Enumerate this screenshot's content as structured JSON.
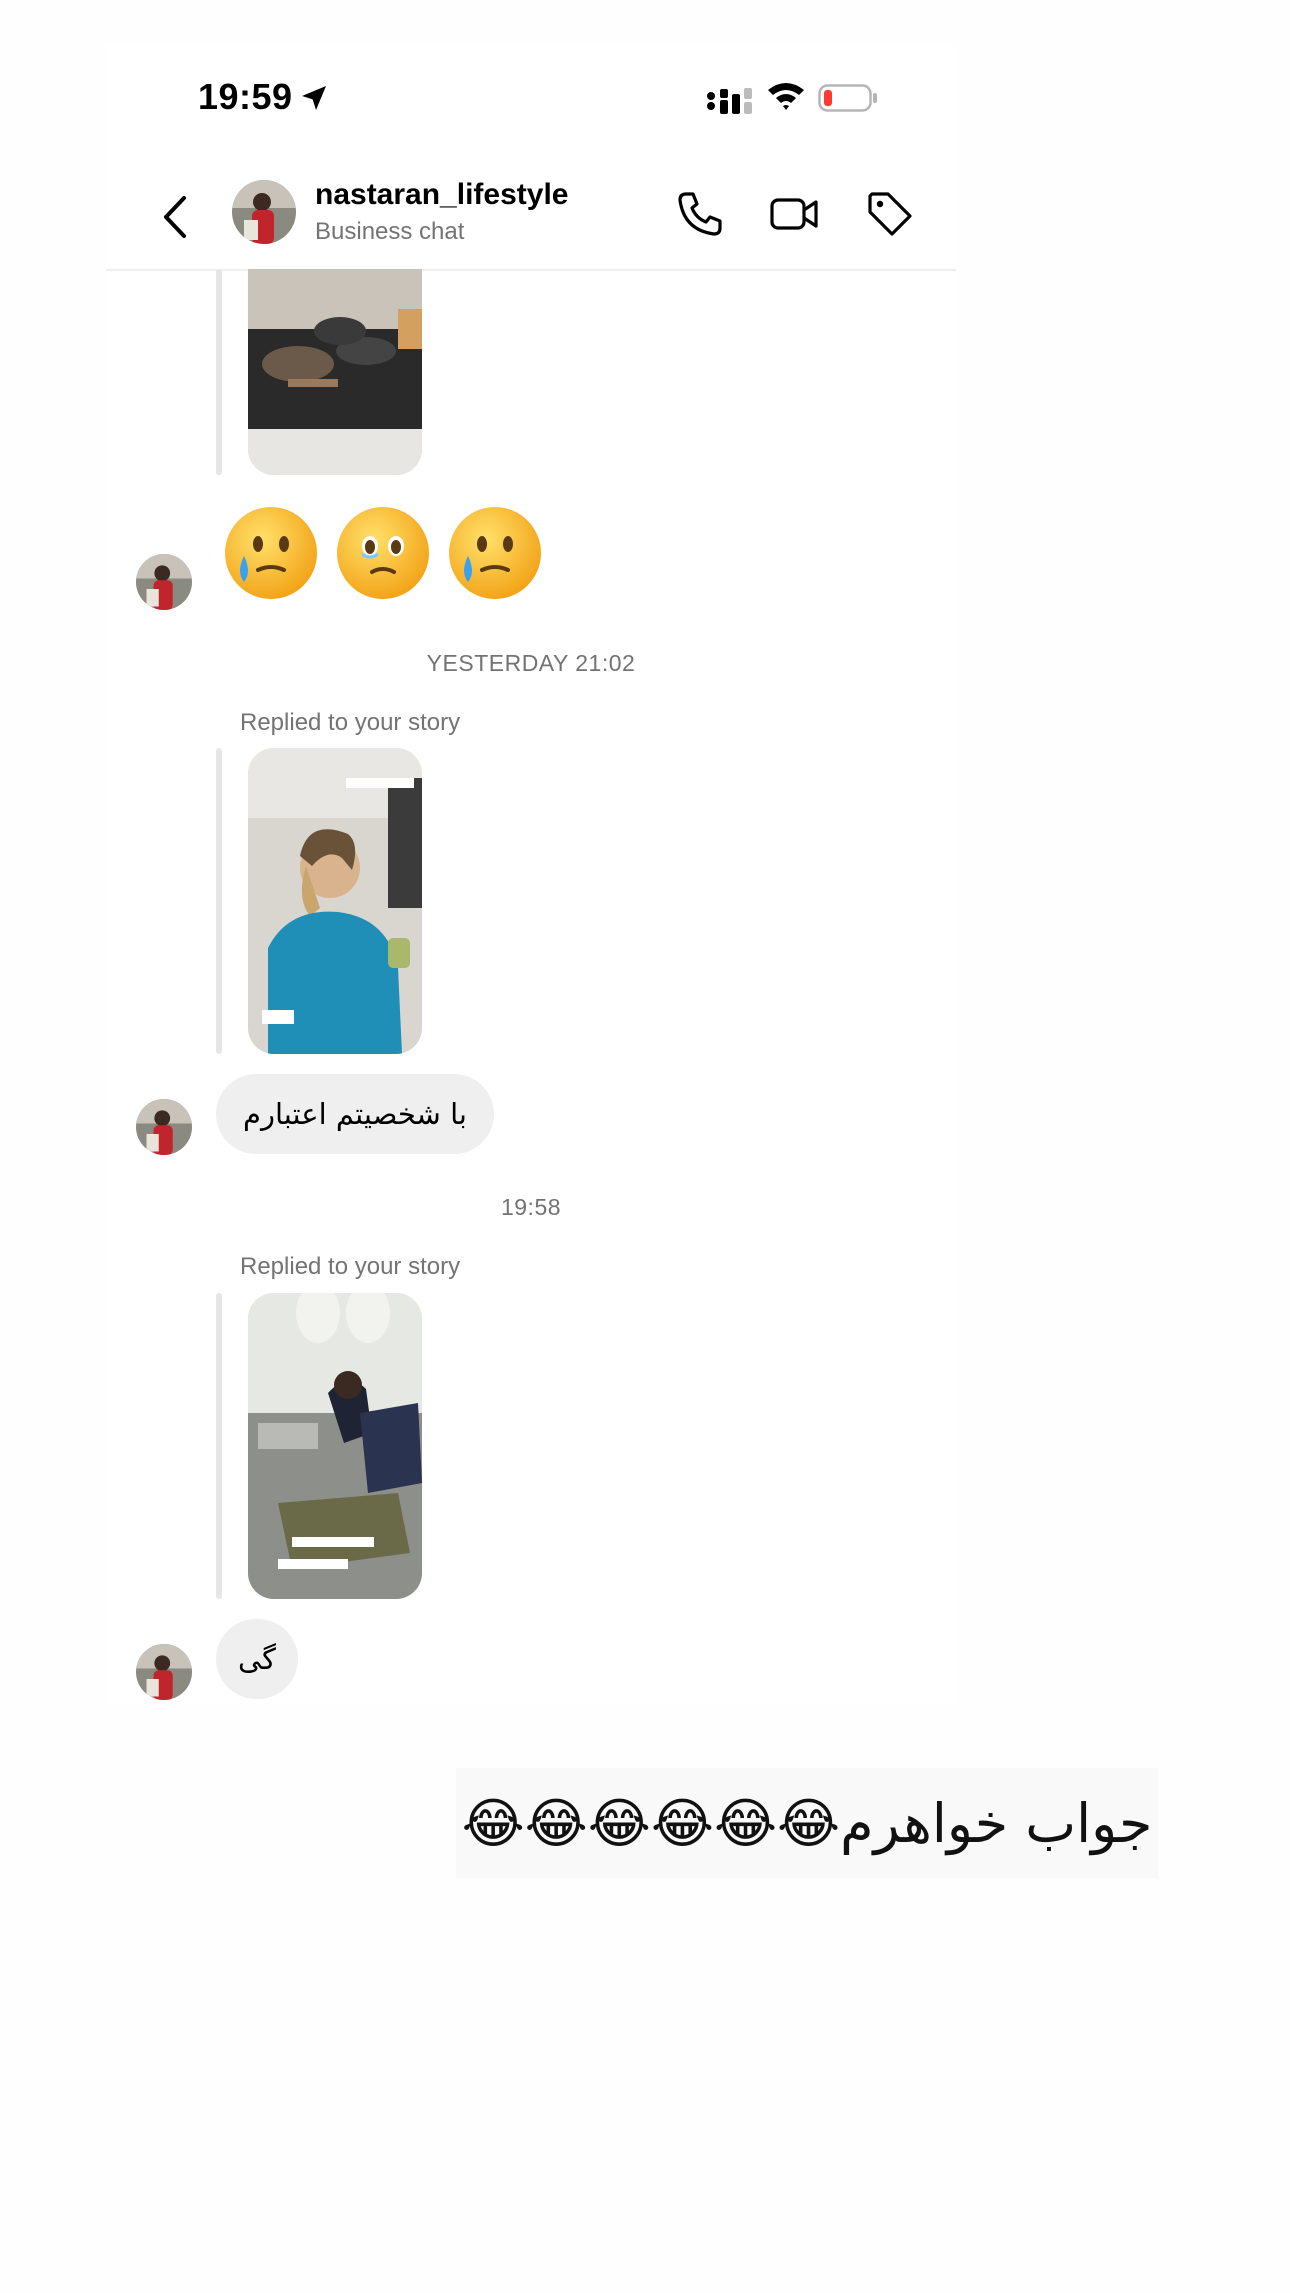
{
  "status_bar": {
    "time": "19:59",
    "battery_color": "#ff3b30"
  },
  "header": {
    "username": "nastaran_lifestyle",
    "subtitle": "Business chat",
    "icons": [
      "chevron-left-icon",
      "phone-icon",
      "video-camera-icon",
      "tag-icon"
    ]
  },
  "chat": {
    "timestamp_1": "YESTERDAY 21:02",
    "replied_label_1": "Replied to your story",
    "message_1": "با شخصیتم اعتبارم",
    "timestamp_2": "19:58",
    "replied_label_2": "Replied to your story",
    "message_2": "گی",
    "emoji_reaction": [
      "crying-face",
      "holding-back-tears-face",
      "crying-face"
    ]
  },
  "overlay_caption": {
    "text": "جواب خواهرم😂😂😂😂😂😂"
  },
  "colors": {
    "bubble": "#efefef",
    "muted_text": "#737373",
    "divider": "#efefef"
  }
}
